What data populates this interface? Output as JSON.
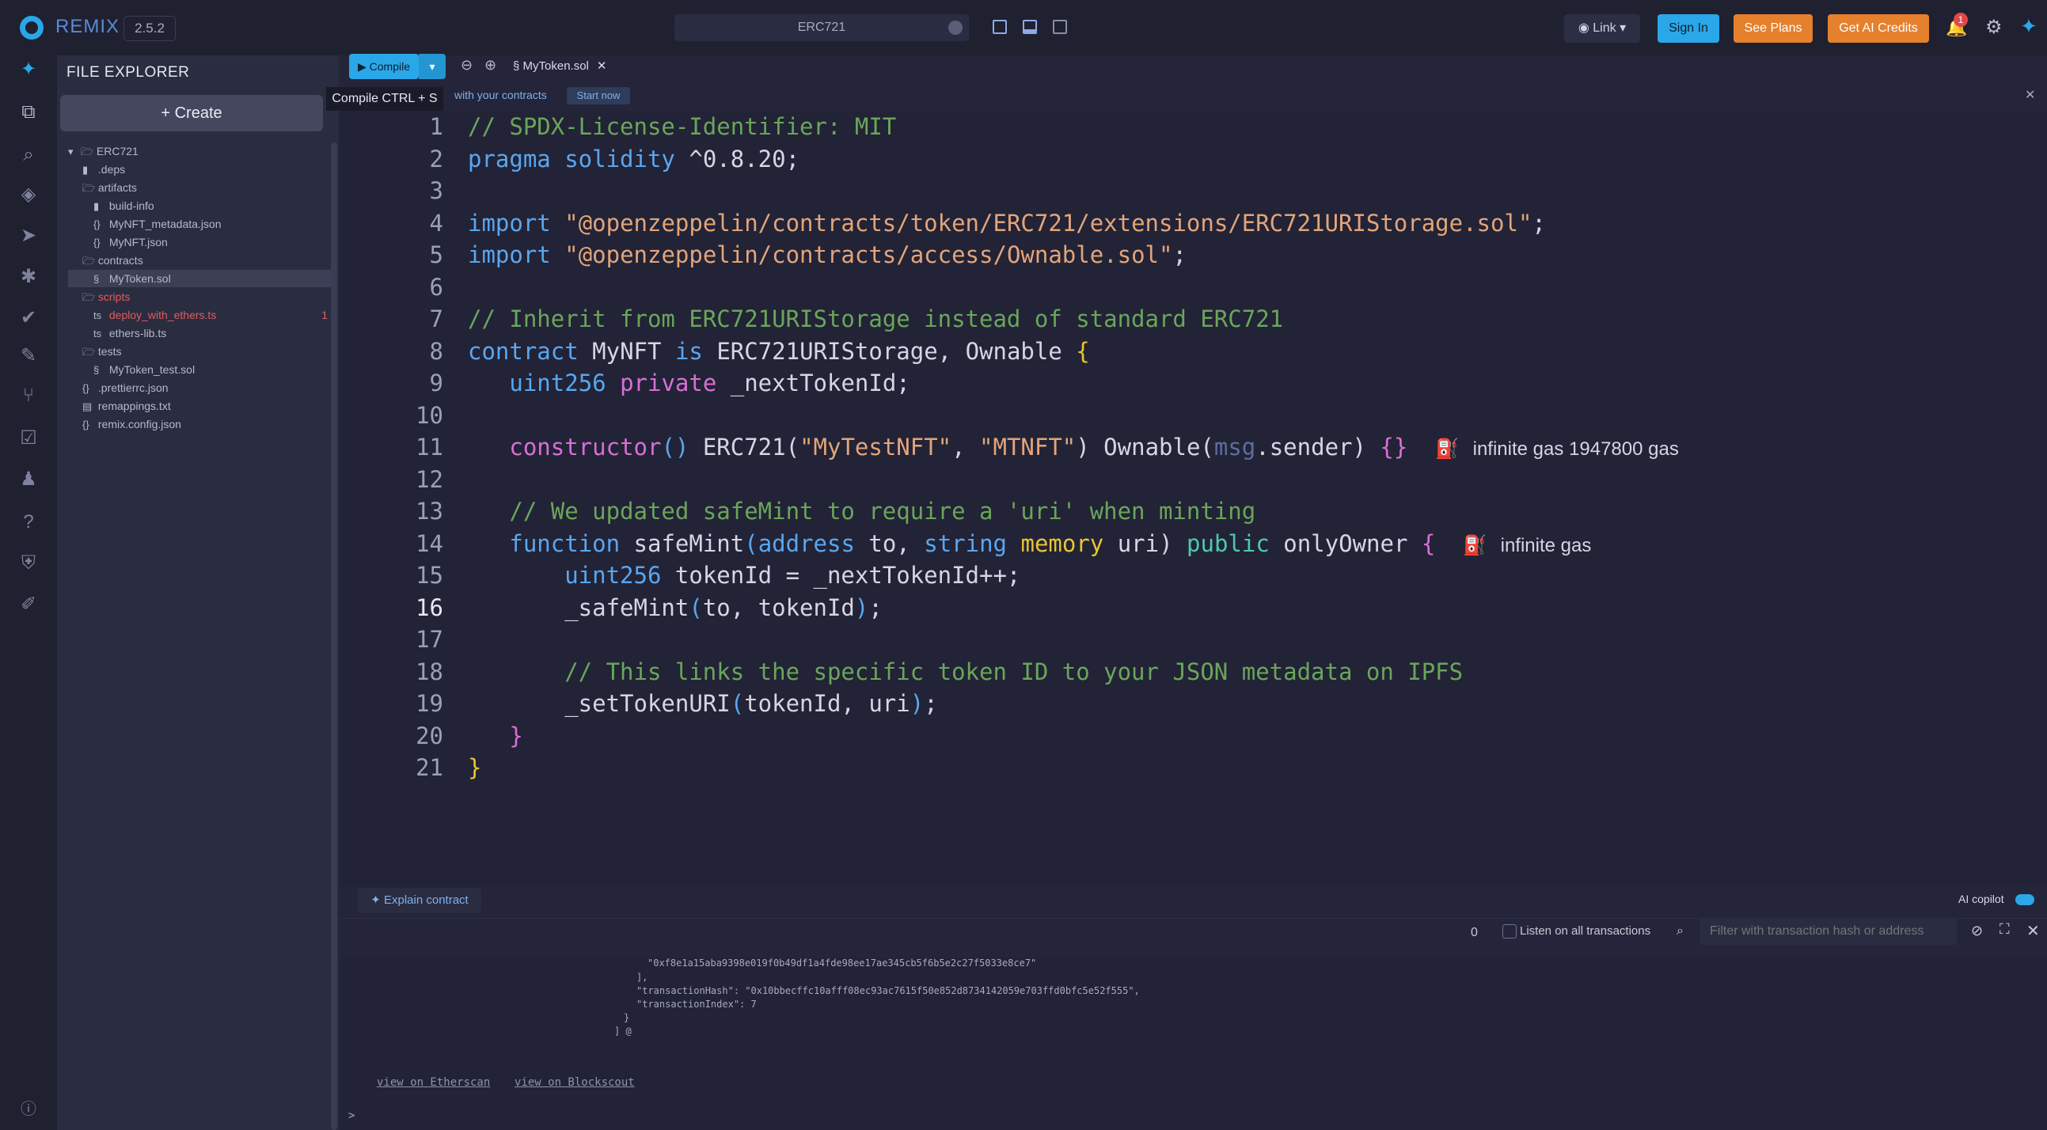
{
  "topbar": {
    "brand": "REMIX",
    "version": "2.5.2",
    "workspace": "ERC721",
    "buttons": {
      "link": "Link",
      "sign_in": "Sign In",
      "see_plans": "See Plans",
      "ai_credits": "Get AI Credits"
    },
    "notification_count": "1",
    "accent": "#2aa7e8",
    "orange": "#e5802d"
  },
  "sidebar_icons": [
    "plugin-logo-icon",
    "file-explorer-icon",
    "search-icon",
    "solidity-compiler-icon",
    "deploy-run-icon",
    "debugger-icon",
    "test-icon",
    "plugin-manager-icon",
    "git-icon",
    "static-analysis-icon",
    "learneth-icon",
    "help-icon",
    "shield-icon",
    "tools-icon",
    "info-icon"
  ],
  "explorer": {
    "title": "FILE EXPLORER",
    "create_label": "Create",
    "tree": [
      {
        "name": "ERC721",
        "type": "folder-open",
        "depth": 0
      },
      {
        "name": ".deps",
        "type": "folder",
        "depth": 1
      },
      {
        "name": "artifacts",
        "type": "folder-open",
        "depth": 1
      },
      {
        "name": "build-info",
        "type": "folder",
        "depth": 2
      },
      {
        "name": "MyNFT_metadata.json",
        "type": "json",
        "depth": 2
      },
      {
        "name": "MyNFT.json",
        "type": "json",
        "depth": 2
      },
      {
        "name": "contracts",
        "type": "folder-open",
        "depth": 1
      },
      {
        "name": "MyToken.sol",
        "type": "sol",
        "depth": 2,
        "selected": true
      },
      {
        "name": "scripts",
        "type": "folder-open",
        "depth": 1,
        "error": true
      },
      {
        "name": "deploy_with_ethers.ts",
        "type": "ts",
        "depth": 2,
        "error": true,
        "badge": "1"
      },
      {
        "name": "ethers-lib.ts",
        "type": "ts",
        "depth": 2
      },
      {
        "name": "tests",
        "type": "folder-open",
        "depth": 1
      },
      {
        "name": "MyToken_test.sol",
        "type": "sol",
        "depth": 2
      },
      {
        "name": ".prettierrc.json",
        "type": "json",
        "depth": 1
      },
      {
        "name": "remappings.txt",
        "type": "txt",
        "depth": 1
      },
      {
        "name": "remix.config.json",
        "type": "json",
        "depth": 1
      }
    ]
  },
  "tabs": {
    "compile_label": "Compile",
    "tooltip": "Compile CTRL + S",
    "file_tab": "MyToken.sol",
    "banner_text": "with your contracts",
    "banner_button": "Start now"
  },
  "editor": {
    "current_line": 16,
    "lines": [
      "// SPDX-License-Identifier: MIT",
      "pragma solidity ^0.8.20;",
      "",
      "import \"@openzeppelin/contracts/token/ERC721/extensions/ERC721URIStorage.sol\";",
      "import \"@openzeppelin/contracts/access/Ownable.sol\";",
      "",
      "// Inherit from ERC721URIStorage instead of standard ERC721",
      "contract MyNFT is ERC721URIStorage, Ownable {",
      "    uint256 private _nextTokenId;",
      "",
      "    constructor() ERC721(\"MyTestNFT\", \"MTNFT\") Ownable(msg.sender) {}",
      "",
      "    // We updated safeMint to require a 'uri' when minting",
      "    function safeMint(address to, string memory uri) public onlyOwner {",
      "        uint256 tokenId = _nextTokenId++;",
      "        _safeMint(to, tokenId);",
      "",
      "        // This links the specific token ID to your JSON metadata on IPFS",
      "        _setTokenURI(tokenId, uri);",
      "    }",
      "}"
    ],
    "gas_line_11": "infinite gas 1947800 gas",
    "gas_line_14": "infinite gas"
  },
  "bottom": {
    "explain_label": "Explain contract",
    "copilot_label": "AI copilot"
  },
  "terminal": {
    "count": "0",
    "listen_label": "Listen on all transactions",
    "filter_placeholder": "Filter with transaction hash or address",
    "log_lines": [
      "\"0xf8e1a15aba9398e019f0b49df1a4fde98ee17ae345cb5f6b5e2c27f5033e8ce7\"",
      "],",
      "\"transactionHash\": \"0x10bbecffc10afff08ec93ac7615f50e852d8734142059e703ffd0bfc5e52f555\",",
      "\"transactionIndex\": 7",
      "}",
      "] @"
    ],
    "link_etherscan": "view on Etherscan",
    "link_blockscout": "view on Blockscout",
    "prompt": ">"
  }
}
